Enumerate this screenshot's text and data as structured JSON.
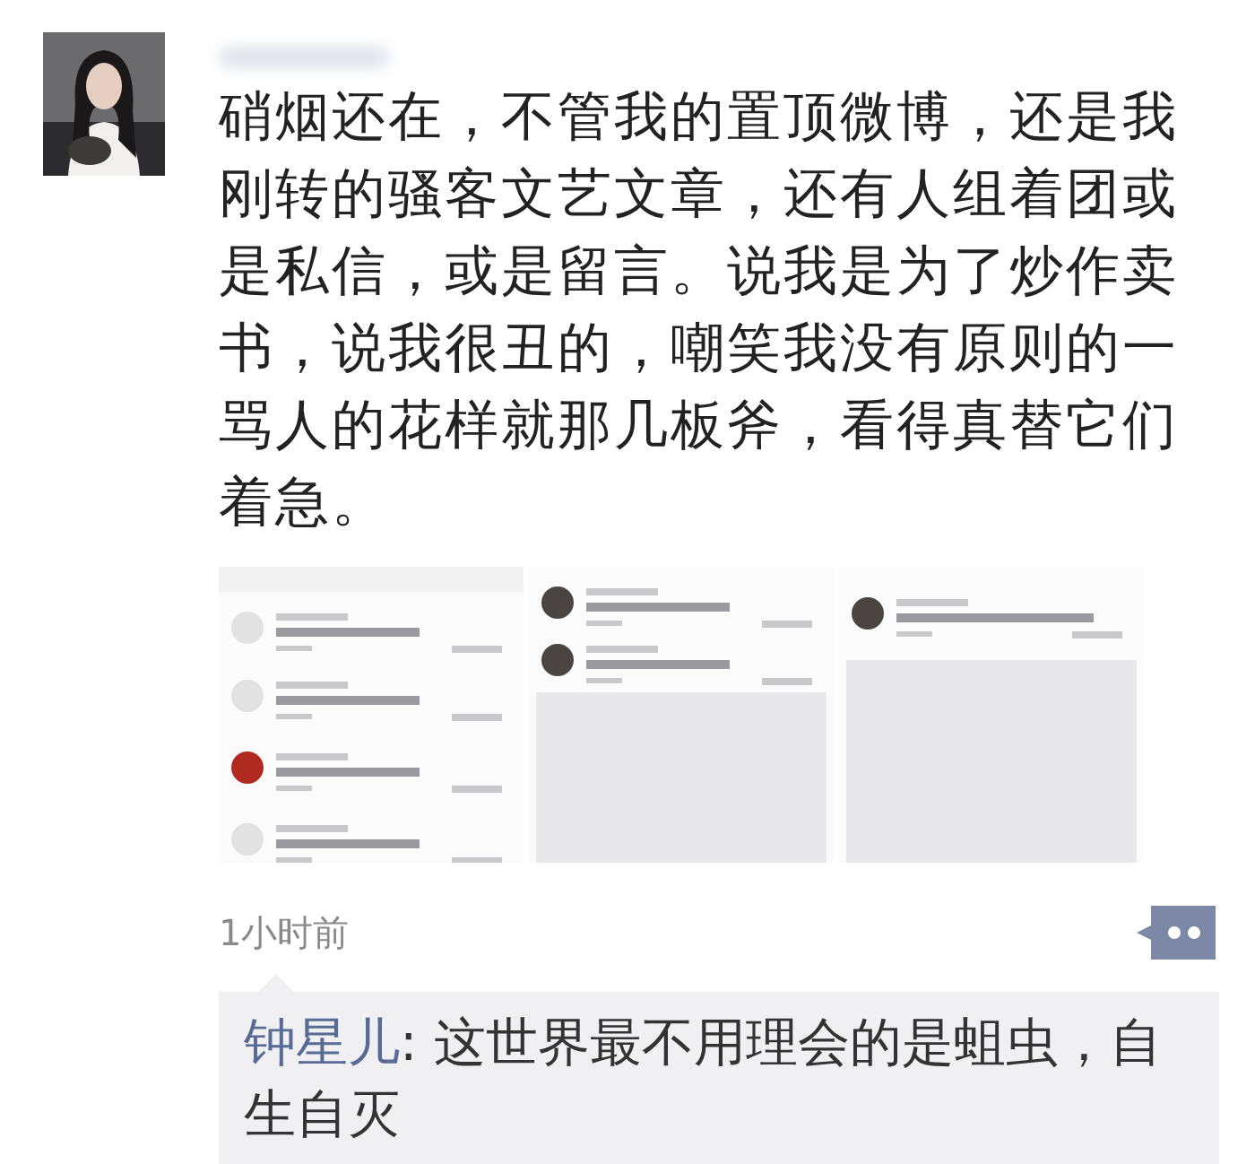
{
  "post": {
    "text": "硝烟还在，不管我的置顶微博，还是我刚转的骚客文艺文章，还有人组着团或是私信，或是留言。说我是为了炒作卖书，说我很丑的，嘲笑我没有原则的一骂人的花样就那几板斧，看得真替它们着急。",
    "time": "1小时前"
  },
  "comments": [
    {
      "author": "钟星儿",
      "text": ": 这世界最不用理会的是蛆虫，自生自灭"
    }
  ]
}
